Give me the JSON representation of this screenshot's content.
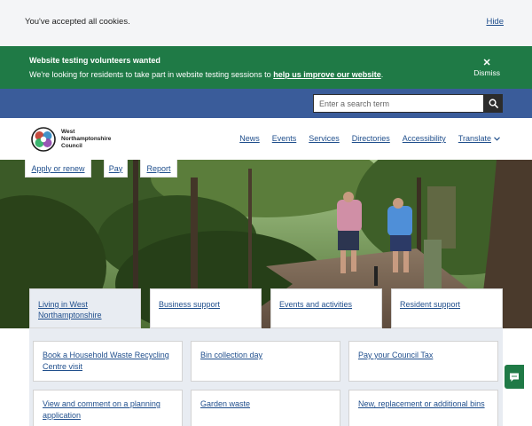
{
  "cookie_bar": {
    "message": "You've accepted all cookies.",
    "hide_label": "Hide"
  },
  "notice": {
    "title": "Website testing volunteers wanted",
    "text": "We're looking for residents to take part in website testing sessions to ",
    "link_text": "help us improve our website",
    "text_end": ".",
    "dismiss_label": "Dismiss"
  },
  "search": {
    "placeholder": "Enter a search term",
    "icon": "search-icon"
  },
  "logo": {
    "line1": "West",
    "line2": "Northamptonshire",
    "line3": "Council"
  },
  "nav": {
    "items": [
      "News",
      "Events",
      "Services",
      "Directories",
      "Accessibility"
    ],
    "translate_label": "Translate"
  },
  "quick_links": [
    "Apply or renew",
    "Pay",
    "Report"
  ],
  "tabs": [
    {
      "label": "Living in West Northamptonshire",
      "active": true
    },
    {
      "label": "Business support",
      "active": false
    },
    {
      "label": "Events and activities",
      "active": false
    },
    {
      "label": "Resident support",
      "active": false
    }
  ],
  "cards": [
    "Book a Household Waste Recycling Centre visit",
    "Bin collection day",
    "Pay your Council Tax",
    "View and comment on a planning application",
    "Garden waste",
    "New, replacement or additional bins"
  ],
  "colors": {
    "brand_green": "#1f7a46",
    "brand_blue": "#3a5c9a",
    "link": "#1f4e8c"
  }
}
